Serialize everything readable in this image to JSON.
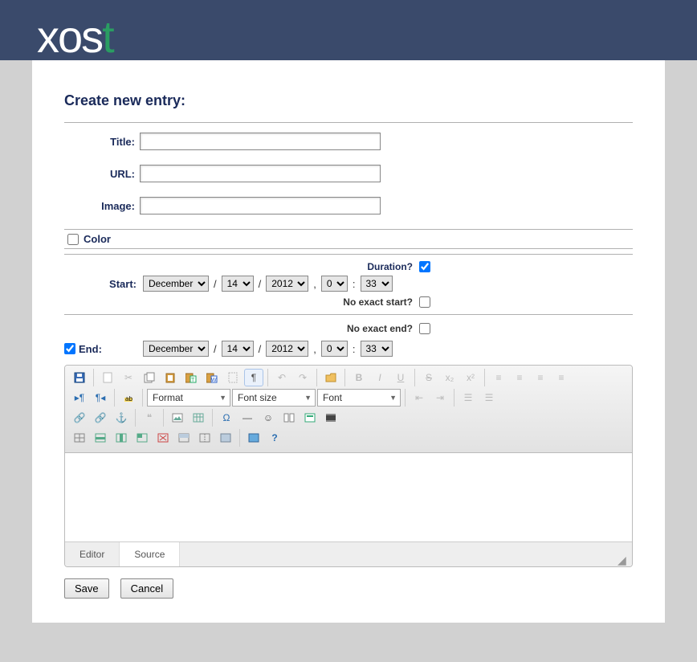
{
  "logo": {
    "main": "xos",
    "accent": "t"
  },
  "page_title": "Create new entry:",
  "fields": {
    "title_label": "Title:",
    "url_label": "URL:",
    "image_label": "Image:",
    "title_value": "",
    "url_value": "",
    "image_value": ""
  },
  "color_label": "Color",
  "color_checked": false,
  "duration": {
    "label": "Duration?",
    "checked": true
  },
  "start": {
    "label": "Start:",
    "month": "December",
    "day": "14",
    "year": "2012",
    "hour": "0",
    "minute": "33",
    "no_exact_label": "No exact start?",
    "no_exact_checked": false
  },
  "end": {
    "label": "End",
    "checked": true,
    "month": "December",
    "day": "14",
    "year": "2012",
    "hour": "0",
    "minute": "33",
    "no_exact_label": "No exact end?",
    "no_exact_checked": false
  },
  "editor": {
    "format_placeholder": "Format",
    "fontsize_placeholder": "Font size",
    "font_placeholder": "Font",
    "tab_editor": "Editor",
    "tab_source": "Source"
  },
  "buttons": {
    "save": "Save",
    "cancel": "Cancel"
  }
}
